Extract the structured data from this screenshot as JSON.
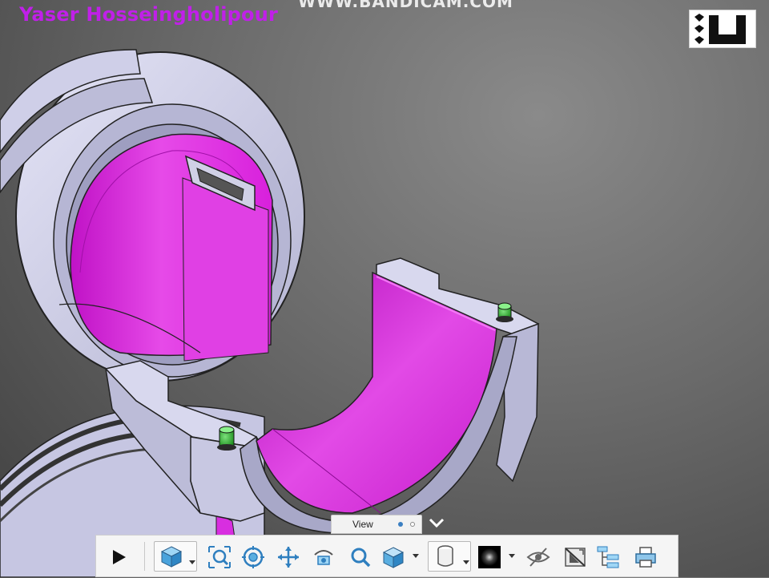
{
  "overlay": {
    "author_name": "Yaser Hosseingholipour",
    "recorder_watermark": "WWW.BANDICAM.COM"
  },
  "viewport": {
    "model_colors": {
      "bearing_shell": "#d2d2ec",
      "bearing_liner": "#d82ee0",
      "dowel_pin": "#2fae2f",
      "background": "#6a6a6a"
    }
  },
  "view_panel": {
    "tab_label": "View",
    "page_indicator": {
      "active": 1,
      "total": 2
    }
  },
  "toolbar": {
    "buttons": [
      {
        "id": "play",
        "icon": "play-icon"
      },
      {
        "id": "home-view",
        "icon": "view-cube-icon",
        "has_dropdown": true
      },
      {
        "id": "zoom-all",
        "icon": "zoom-all-icon"
      },
      {
        "id": "orbit",
        "icon": "orbit-icon"
      },
      {
        "id": "pan",
        "icon": "pan-icon"
      },
      {
        "id": "look-at",
        "icon": "look-at-icon"
      },
      {
        "id": "zoom",
        "icon": "zoom-icon"
      },
      {
        "id": "display-mode",
        "icon": "shaded-cube-icon",
        "has_dropdown": true
      },
      {
        "id": "projection",
        "icon": "cylinder-icon",
        "has_dropdown": true
      },
      {
        "id": "shading",
        "icon": "sphere-icon",
        "has_dropdown": true
      },
      {
        "id": "visibility",
        "icon": "eye-icon"
      },
      {
        "id": "section",
        "icon": "section-view-icon"
      },
      {
        "id": "model-tree",
        "icon": "tree-icon"
      },
      {
        "id": "print",
        "icon": "printer-icon"
      }
    ]
  }
}
